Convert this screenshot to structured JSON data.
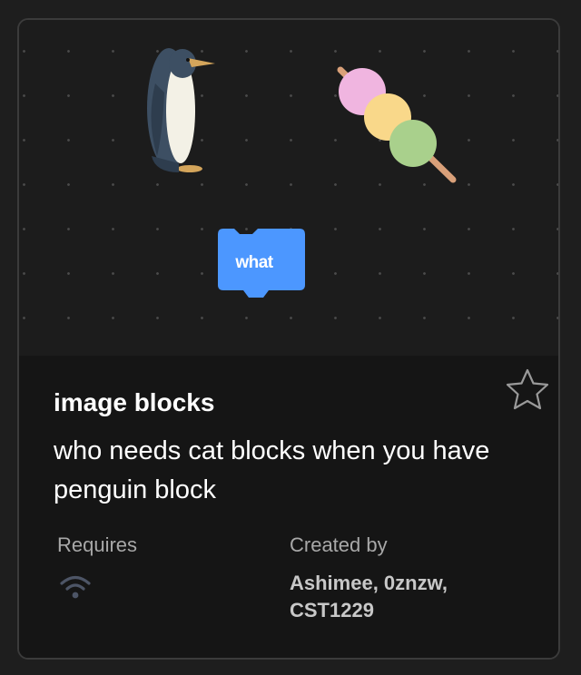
{
  "extension": {
    "title": "image blocks",
    "description": "who needs cat blocks when you have penguin block",
    "preview": {
      "block_label": "what",
      "block_color": "#4c97ff"
    },
    "favorite_icon": "star-outline-icon",
    "requires": {
      "label": "Requires",
      "icon": "wifi-icon"
    },
    "created_by": {
      "label": "Created by",
      "authors": "Ashimee, 0znzw, CST1229"
    }
  }
}
